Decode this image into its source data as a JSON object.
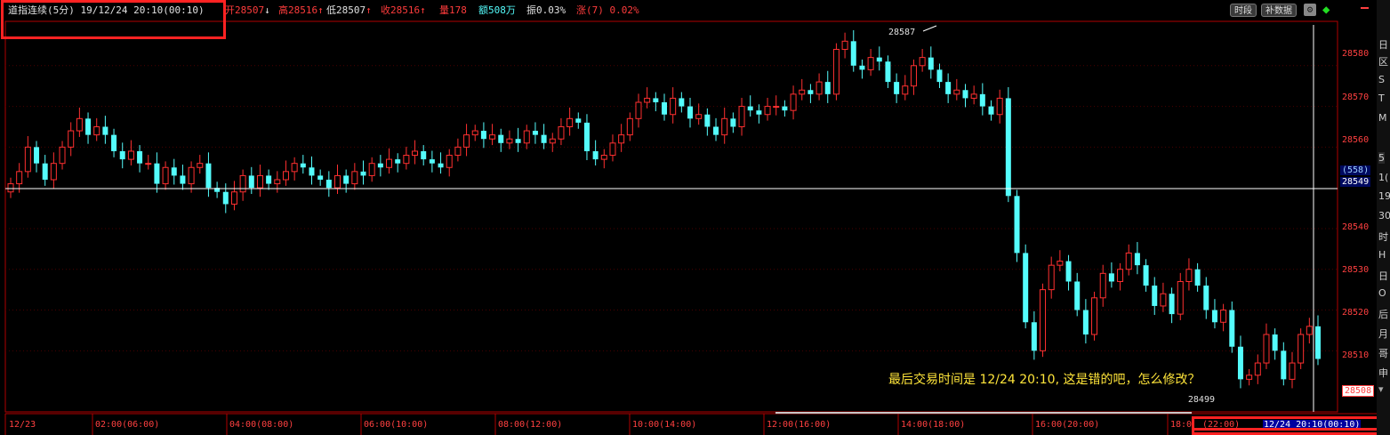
{
  "header": {
    "instrument": "道指连续(5分) 19/12/24 20:10(00:10)",
    "open": "开28507",
    "high": "高28516",
    "low": "低28507",
    "close": "收28516",
    "volume": "量178",
    "amount": "额508万",
    "amplitude": "振0.03%",
    "change": "涨(7) 0.02%",
    "btn_period": "时段",
    "btn_supplement": "补数据"
  },
  "chart_data": {
    "type": "candlestick",
    "ylim": [
      28495,
      28590
    ],
    "y_ticks": [
      28510,
      28520,
      28530,
      28540,
      28560,
      28570,
      28580
    ],
    "crosshair": {
      "value": 28549,
      "count_label": "(558)"
    },
    "last_price": 28508,
    "max_label": "28587",
    "min_label": "28499",
    "x_ticks": [
      "12/23",
      "02:00(06:00)",
      "04:00(08:00)",
      "06:00(10:00)",
      "08:00(12:00)",
      "10:00(14:00)",
      "12:00(16:00)",
      "14:00(18:00)",
      "16:00(20:00)",
      "18:0",
      "(22:00)",
      "12/24  20:10(00:10)"
    ],
    "closes": [
      28551,
      28554,
      28560,
      28556,
      28552,
      28556,
      28560,
      28564,
      28567,
      28563,
      28565,
      28563,
      28559,
      28557,
      28559,
      28556,
      28556,
      28551,
      28555,
      28553,
      28551,
      28555,
      28556,
      28550,
      28549,
      28546,
      28549,
      28553,
      28550,
      28553,
      28551,
      28552,
      28554,
      28556,
      28555,
      28553,
      28552,
      28550,
      28553,
      28551,
      28554,
      28553,
      28556,
      28555,
      28557,
      28556,
      28558,
      28559,
      28557,
      28556,
      28555,
      28558,
      28560,
      28563,
      28564,
      28562,
      28563,
      28561,
      28562,
      28561,
      28564,
      28563,
      28561,
      28562,
      28565,
      28567,
      28566,
      28559,
      28557,
      28558,
      28561,
      28563,
      28567,
      28571,
      28572,
      28571,
      28568,
      28572,
      28570,
      28567,
      28568,
      28565,
      28563,
      28567,
      28565,
      28570,
      28569,
      28568,
      28570,
      28570,
      28569,
      28573,
      28574,
      28573,
      28576,
      28573,
      28584,
      28586,
      28580,
      28579,
      28582,
      28581,
      28576,
      28573,
      28575,
      28580,
      28582,
      28579,
      28576,
      28573,
      28574,
      28572,
      28573,
      28570,
      28568,
      28572,
      28548,
      28534,
      28517,
      28510,
      28525,
      28531,
      28532,
      28527,
      28520,
      28514,
      28523,
      28529,
      28527,
      28530,
      28534,
      28531,
      28526,
      28521,
      28524,
      28519,
      28527,
      28530,
      28526,
      28520,
      28517,
      28520,
      28511,
      28503,
      28504,
      28507,
      28514,
      28510,
      28503,
      28507,
      28514,
      28516,
      28508
    ]
  },
  "annotation": "最后交易时间是 12/24  20:10, 这是错的吧，怎么修改？",
  "right_strip": [
    "日",
    "区",
    "S",
    "T",
    "M",
    "5",
    "1(",
    "19",
    "30",
    "时",
    "H",
    "日",
    "O",
    "后",
    "月",
    "哥",
    "申"
  ]
}
